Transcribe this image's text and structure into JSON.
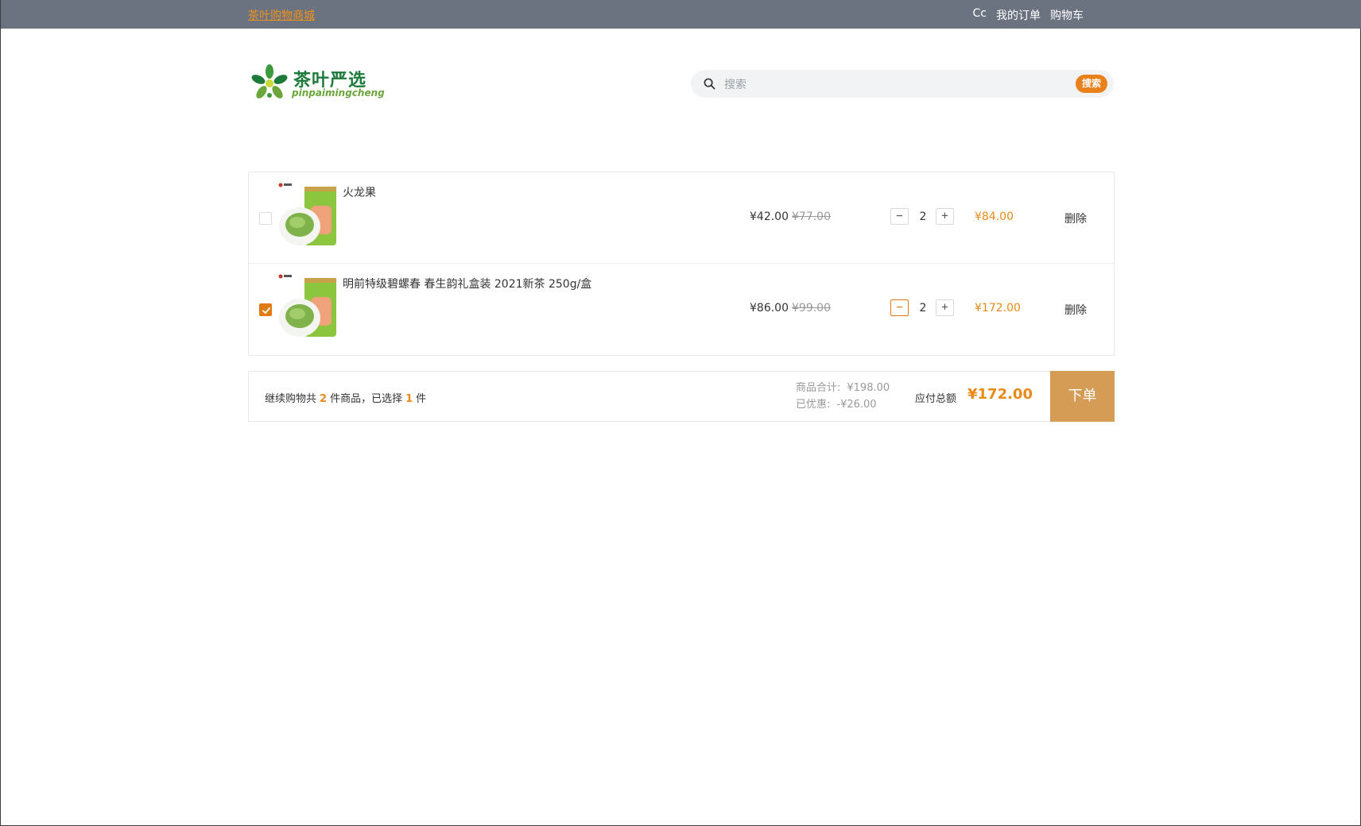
{
  "topbar": {
    "site_name": "茶叶购物商城",
    "user_name": "Cc",
    "my_orders": "我的订单",
    "cart": "购物车"
  },
  "header": {
    "logo_title": "茶叶严选",
    "logo_subtitle": "pinpaimingcheng",
    "search_placeholder": "搜索",
    "search_button": "搜索"
  },
  "cart": {
    "items": [
      {
        "name": "火龙果",
        "price": "¥42.00",
        "original_price": "¥77.00",
        "quantity": "2",
        "subtotal": "¥84.00",
        "checked": false,
        "delete_label": "删除"
      },
      {
        "name": "明前特级碧螺春 春生韵礼盒装 2021新茶 250g/盒",
        "price": "¥86.00",
        "original_price": "¥99.00",
        "quantity": "2",
        "subtotal": "¥172.00",
        "checked": true,
        "delete_label": "删除"
      }
    ],
    "minus_symbol": "−",
    "plus_symbol": "+"
  },
  "summary": {
    "prefix": "继续购物共",
    "total_count": "2",
    "middle": "件商品，已选择",
    "selected_count": "1",
    "suffix": "件",
    "goods_total_label": "商品合计:",
    "goods_total_value": "¥198.00",
    "discount_label": "已优惠:",
    "discount_value": "-¥26.00",
    "payable_label": "应付总额",
    "payable_value": "¥172.00",
    "order_button": "下单"
  },
  "colors": {
    "topbar": "#6c7380",
    "accent": "#e88a1a",
    "order_button": "#d59c55"
  }
}
